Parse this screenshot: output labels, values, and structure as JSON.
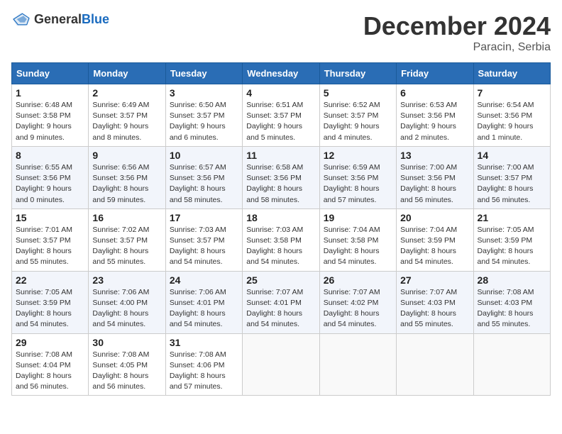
{
  "header": {
    "logo_general": "General",
    "logo_blue": "Blue",
    "month_title": "December 2024",
    "subtitle": "Paracin, Serbia"
  },
  "days_of_week": [
    "Sunday",
    "Monday",
    "Tuesday",
    "Wednesday",
    "Thursday",
    "Friday",
    "Saturday"
  ],
  "weeks": [
    [
      {
        "day": "1",
        "info": "Sunrise: 6:48 AM\nSunset: 3:58 PM\nDaylight: 9 hours\nand 9 minutes."
      },
      {
        "day": "2",
        "info": "Sunrise: 6:49 AM\nSunset: 3:57 PM\nDaylight: 9 hours\nand 8 minutes."
      },
      {
        "day": "3",
        "info": "Sunrise: 6:50 AM\nSunset: 3:57 PM\nDaylight: 9 hours\nand 6 minutes."
      },
      {
        "day": "4",
        "info": "Sunrise: 6:51 AM\nSunset: 3:57 PM\nDaylight: 9 hours\nand 5 minutes."
      },
      {
        "day": "5",
        "info": "Sunrise: 6:52 AM\nSunset: 3:57 PM\nDaylight: 9 hours\nand 4 minutes."
      },
      {
        "day": "6",
        "info": "Sunrise: 6:53 AM\nSunset: 3:56 PM\nDaylight: 9 hours\nand 2 minutes."
      },
      {
        "day": "7",
        "info": "Sunrise: 6:54 AM\nSunset: 3:56 PM\nDaylight: 9 hours\nand 1 minute."
      }
    ],
    [
      {
        "day": "8",
        "info": "Sunrise: 6:55 AM\nSunset: 3:56 PM\nDaylight: 9 hours\nand 0 minutes."
      },
      {
        "day": "9",
        "info": "Sunrise: 6:56 AM\nSunset: 3:56 PM\nDaylight: 8 hours\nand 59 minutes."
      },
      {
        "day": "10",
        "info": "Sunrise: 6:57 AM\nSunset: 3:56 PM\nDaylight: 8 hours\nand 58 minutes."
      },
      {
        "day": "11",
        "info": "Sunrise: 6:58 AM\nSunset: 3:56 PM\nDaylight: 8 hours\nand 58 minutes."
      },
      {
        "day": "12",
        "info": "Sunrise: 6:59 AM\nSunset: 3:56 PM\nDaylight: 8 hours\nand 57 minutes."
      },
      {
        "day": "13",
        "info": "Sunrise: 7:00 AM\nSunset: 3:56 PM\nDaylight: 8 hours\nand 56 minutes."
      },
      {
        "day": "14",
        "info": "Sunrise: 7:00 AM\nSunset: 3:57 PM\nDaylight: 8 hours\nand 56 minutes."
      }
    ],
    [
      {
        "day": "15",
        "info": "Sunrise: 7:01 AM\nSunset: 3:57 PM\nDaylight: 8 hours\nand 55 minutes."
      },
      {
        "day": "16",
        "info": "Sunrise: 7:02 AM\nSunset: 3:57 PM\nDaylight: 8 hours\nand 55 minutes."
      },
      {
        "day": "17",
        "info": "Sunrise: 7:03 AM\nSunset: 3:57 PM\nDaylight: 8 hours\nand 54 minutes."
      },
      {
        "day": "18",
        "info": "Sunrise: 7:03 AM\nSunset: 3:58 PM\nDaylight: 8 hours\nand 54 minutes."
      },
      {
        "day": "19",
        "info": "Sunrise: 7:04 AM\nSunset: 3:58 PM\nDaylight: 8 hours\nand 54 minutes."
      },
      {
        "day": "20",
        "info": "Sunrise: 7:04 AM\nSunset: 3:59 PM\nDaylight: 8 hours\nand 54 minutes."
      },
      {
        "day": "21",
        "info": "Sunrise: 7:05 AM\nSunset: 3:59 PM\nDaylight: 8 hours\nand 54 minutes."
      }
    ],
    [
      {
        "day": "22",
        "info": "Sunrise: 7:05 AM\nSunset: 3:59 PM\nDaylight: 8 hours\nand 54 minutes."
      },
      {
        "day": "23",
        "info": "Sunrise: 7:06 AM\nSunset: 4:00 PM\nDaylight: 8 hours\nand 54 minutes."
      },
      {
        "day": "24",
        "info": "Sunrise: 7:06 AM\nSunset: 4:01 PM\nDaylight: 8 hours\nand 54 minutes."
      },
      {
        "day": "25",
        "info": "Sunrise: 7:07 AM\nSunset: 4:01 PM\nDaylight: 8 hours\nand 54 minutes."
      },
      {
        "day": "26",
        "info": "Sunrise: 7:07 AM\nSunset: 4:02 PM\nDaylight: 8 hours\nand 54 minutes."
      },
      {
        "day": "27",
        "info": "Sunrise: 7:07 AM\nSunset: 4:03 PM\nDaylight: 8 hours\nand 55 minutes."
      },
      {
        "day": "28",
        "info": "Sunrise: 7:08 AM\nSunset: 4:03 PM\nDaylight: 8 hours\nand 55 minutes."
      }
    ],
    [
      {
        "day": "29",
        "info": "Sunrise: 7:08 AM\nSunset: 4:04 PM\nDaylight: 8 hours\nand 56 minutes."
      },
      {
        "day": "30",
        "info": "Sunrise: 7:08 AM\nSunset: 4:05 PM\nDaylight: 8 hours\nand 56 minutes."
      },
      {
        "day": "31",
        "info": "Sunrise: 7:08 AM\nSunset: 4:06 PM\nDaylight: 8 hours\nand 57 minutes."
      },
      null,
      null,
      null,
      null
    ]
  ]
}
